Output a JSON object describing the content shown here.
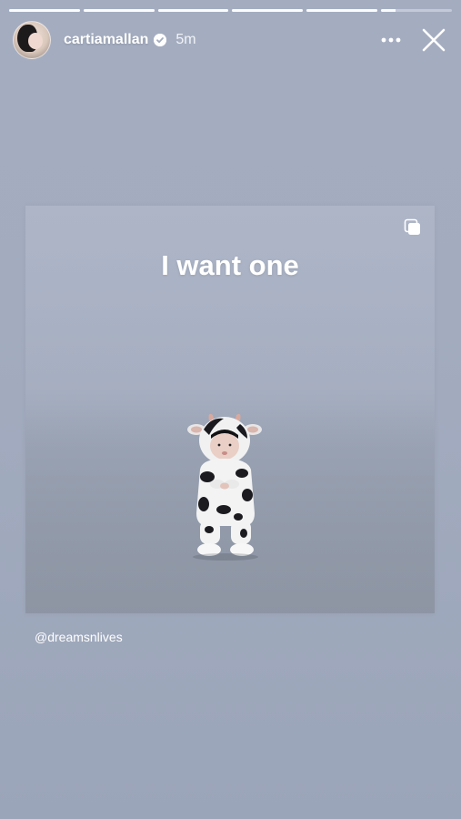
{
  "progress": [
    1,
    1,
    1,
    1,
    1,
    0.2
  ],
  "header": {
    "username": "cartiamallan",
    "time": "5m",
    "more_icon": "more-horizontal-icon",
    "close_icon": "close-icon",
    "verified_icon": "verified-badge-icon"
  },
  "post": {
    "caption": "I want one",
    "multi_icon": "multiple-posts-icon"
  },
  "mention": "@dreamsnlives",
  "colors": {
    "background": "#a3acbf",
    "text": "#ffffff"
  }
}
